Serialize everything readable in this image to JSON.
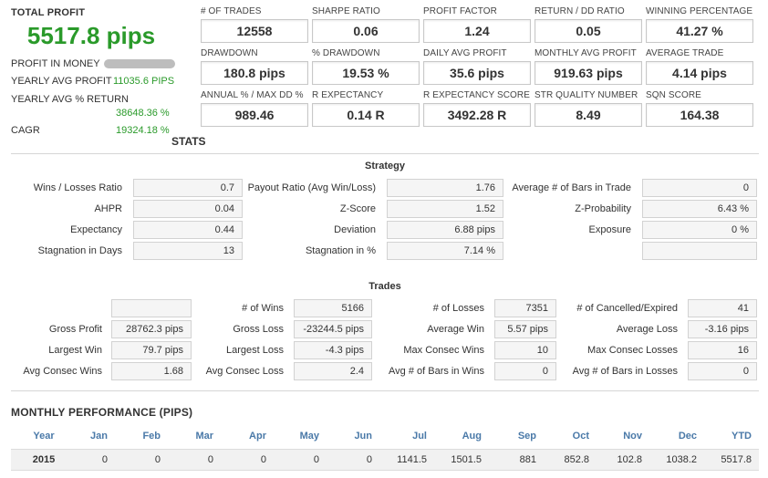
{
  "summary": {
    "total_profit_label": "TOTAL PROFIT",
    "total_profit_value": "5517.8 pips",
    "profit_in_money_label": "PROFIT IN MONEY",
    "yearly_avg_profit_label": "YEARLY AVG PROFIT",
    "yearly_avg_profit_value": "11035.6 PIPS",
    "yearly_avg_return_label": "YEARLY AVG % RETURN",
    "yearly_avg_return_value": "38648.36 %",
    "cagr_label": "CAGR",
    "cagr_value": "19324.18 %",
    "stats_heading": "STATS"
  },
  "metrics": [
    {
      "label": "# OF TRADES",
      "value": "12558"
    },
    {
      "label": "SHARPE RATIO",
      "value": "0.06"
    },
    {
      "label": "PROFIT FACTOR",
      "value": "1.24"
    },
    {
      "label": "RETURN / DD RATIO",
      "value": "0.05"
    },
    {
      "label": "WINNING PERCENTAGE",
      "value": "41.27 %"
    },
    {
      "label": "DRAWDOWN",
      "value": "180.8 pips"
    },
    {
      "label": "% DRAWDOWN",
      "value": "19.53 %"
    },
    {
      "label": "DAILY AVG PROFIT",
      "value": "35.6 pips"
    },
    {
      "label": "MONTHLY AVG PROFIT",
      "value": "919.63 pips"
    },
    {
      "label": "AVERAGE TRADE",
      "value": "4.14 pips"
    },
    {
      "label": "ANNUAL % / MAX DD %",
      "value": "989.46"
    },
    {
      "label": "R EXPECTANCY",
      "value": "0.14 R"
    },
    {
      "label": "R EXPECTANCY SCORE",
      "value": "3492.28 R"
    },
    {
      "label": "STR QUALITY NUMBER",
      "value": "8.49"
    },
    {
      "label": "SQN SCORE",
      "value": "164.38"
    }
  ],
  "strategy": {
    "title": "Strategy",
    "rows": [
      [
        {
          "label": "Wins / Losses Ratio",
          "value": "0.7"
        },
        {
          "label": "Payout Ratio (Avg Win/Loss)",
          "value": "1.76"
        },
        {
          "label": "Average # of Bars in Trade",
          "value": "0"
        }
      ],
      [
        {
          "label": "AHPR",
          "value": "0.04"
        },
        {
          "label": "Z-Score",
          "value": "1.52"
        },
        {
          "label": "Z-Probability",
          "value": "6.43 %"
        }
      ],
      [
        {
          "label": "Expectancy",
          "value": "0.44"
        },
        {
          "label": "Deviation",
          "value": "6.88 pips"
        },
        {
          "label": "Exposure",
          "value": "0 %"
        }
      ],
      [
        {
          "label": "Stagnation in Days",
          "value": "13"
        },
        {
          "label": "Stagnation in %",
          "value": "7.14 %"
        },
        {
          "label": "",
          "value": ""
        }
      ]
    ]
  },
  "trades": {
    "title": "Trades",
    "rows": [
      [
        {
          "label": "",
          "value": ""
        },
        {
          "label": "# of Wins",
          "value": "5166"
        },
        {
          "label": "# of Losses",
          "value": "7351"
        },
        {
          "label": "# of Cancelled/Expired",
          "value": "41"
        }
      ],
      [
        {
          "label": "Gross Profit",
          "value": "28762.3 pips"
        },
        {
          "label": "Gross Loss",
          "value": "-23244.5 pips"
        },
        {
          "label": "Average Win",
          "value": "5.57 pips"
        },
        {
          "label": "Average Loss",
          "value": "-3.16 pips"
        }
      ],
      [
        {
          "label": "Largest Win",
          "value": "79.7 pips"
        },
        {
          "label": "Largest Loss",
          "value": "-4.3 pips"
        },
        {
          "label": "Max Consec Wins",
          "value": "10"
        },
        {
          "label": "Max Consec Losses",
          "value": "16"
        }
      ],
      [
        {
          "label": "Avg Consec Wins",
          "value": "1.68"
        },
        {
          "label": "Avg Consec Loss",
          "value": "2.4"
        },
        {
          "label": "Avg # of Bars in Wins",
          "value": "0"
        },
        {
          "label": "Avg # of Bars in Losses",
          "value": "0"
        }
      ]
    ]
  },
  "monthly": {
    "heading": "MONTHLY PERFORMANCE (PIPS)",
    "headers": [
      "Year",
      "Jan",
      "Feb",
      "Mar",
      "Apr",
      "May",
      "Jun",
      "Jul",
      "Aug",
      "Sep",
      "Oct",
      "Nov",
      "Dec",
      "YTD"
    ],
    "rows": [
      [
        "2015",
        "0",
        "0",
        "0",
        "0",
        "0",
        "0",
        "1141.5",
        "1501.5",
        "881",
        "852.8",
        "102.8",
        "1038.2",
        "5517.8"
      ]
    ]
  },
  "colors": {
    "profit_green": "#2a9a2a",
    "header_blue": "#4a79a8"
  }
}
